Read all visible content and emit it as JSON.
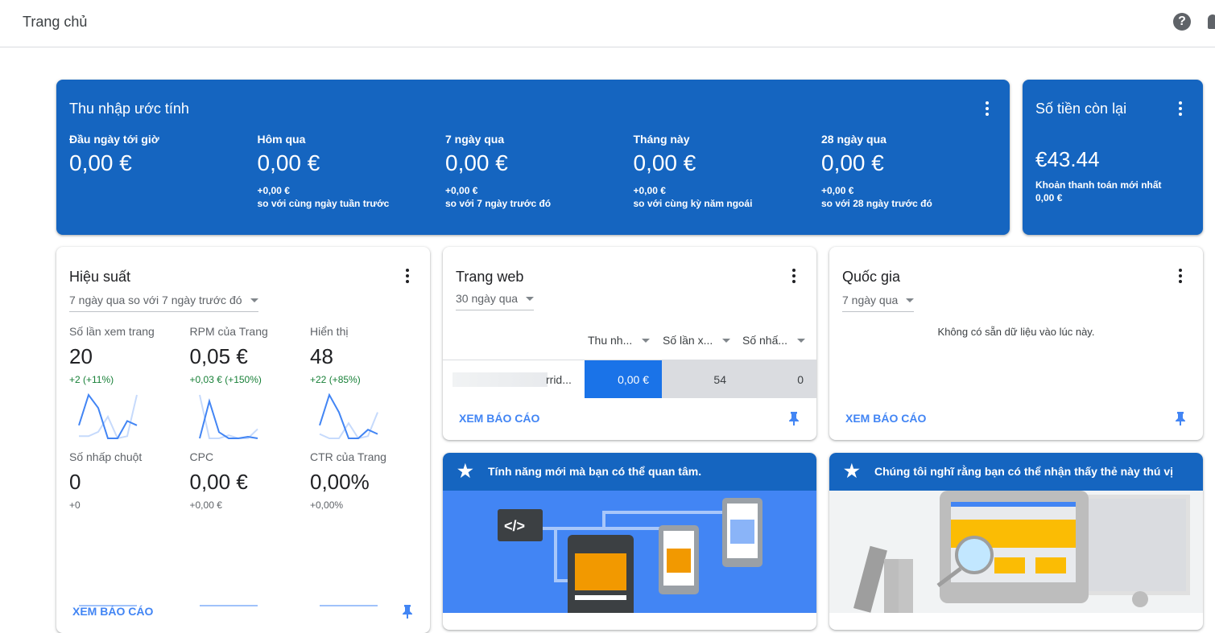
{
  "header": {
    "title": "Trang chủ",
    "help_icon": "help-icon",
    "notification_icon": "bell-icon"
  },
  "earnings": {
    "title": "Thu nhập ước tính",
    "metrics": [
      {
        "label": "Đầu ngày tới giờ",
        "value": "0,00 €",
        "delta": "",
        "compare": ""
      },
      {
        "label": "Hôm qua",
        "value": "0,00 €",
        "delta": "+0,00 €",
        "compare": "so với cùng ngày tuần trước"
      },
      {
        "label": "7 ngày qua",
        "value": "0,00 €",
        "delta": "+0,00 €",
        "compare": "so với 7 ngày trước đó"
      },
      {
        "label": "Tháng này",
        "value": "0,00 €",
        "delta": "+0,00 €",
        "compare": "so với cùng kỳ năm ngoái"
      },
      {
        "label": "28 ngày qua",
        "value": "0,00 €",
        "delta": "+0,00 €",
        "compare": "so với 28 ngày trước đó"
      }
    ]
  },
  "balance": {
    "title": "Số tiền còn lại",
    "value": "€43.44",
    "last_payment_label": "Khoản thanh toán mới nhất",
    "last_payment_value": "0,00 €"
  },
  "performance": {
    "title": "Hiệu suất",
    "range": "7 ngày qua so với 7 ngày trước đó",
    "link": "XEM BÁO CÁO",
    "metrics": [
      {
        "label": "Số lần xem trang",
        "value": "20",
        "delta": "+2 (+11%)",
        "current": [
          6,
          20,
          14,
          0,
          0,
          8,
          6
        ],
        "previous": [
          1,
          1,
          3,
          10,
          0,
          1,
          20
        ]
      },
      {
        "label": "RPM của Trang",
        "value": "0,05 €",
        "delta": "+0,03 € (+150%)",
        "current": [
          0,
          12,
          2,
          0,
          0,
          0.5,
          0
        ],
        "previous": [
          14,
          0,
          0,
          1,
          0,
          0,
          3
        ]
      },
      {
        "label": "Hiển thị",
        "value": "48",
        "delta": "+22 (+85%)",
        "current": [
          6,
          20,
          12,
          0,
          0,
          4,
          2
        ],
        "previous": [
          2,
          0,
          0,
          7,
          0,
          1,
          12
        ]
      },
      {
        "label": "Số nhấp chuột",
        "value": "0",
        "delta": "+0",
        "current": [
          0,
          0,
          0,
          0,
          0,
          0,
          0
        ],
        "previous": [
          0,
          0,
          0,
          0,
          0,
          0,
          0
        ]
      },
      {
        "label": "CPC",
        "value": "0,00 €",
        "delta": "+0,00 €",
        "current": [
          0,
          0,
          0,
          0,
          0,
          0,
          0
        ],
        "previous": [
          0,
          0,
          0,
          0,
          0,
          0,
          0
        ]
      },
      {
        "label": "CTR của Trang",
        "value": "0,00%",
        "delta": "+0,00%",
        "current": [
          0,
          0,
          0,
          0,
          0,
          0,
          0
        ],
        "previous": [
          0,
          0,
          0,
          0,
          0,
          0,
          0
        ]
      }
    ]
  },
  "sites": {
    "title": "Trang web",
    "range": "30 ngày qua",
    "columns": [
      "Thu nh...",
      "Số lần x...",
      "Số nhấ..."
    ],
    "rows": [
      {
        "site": "rrid...",
        "earnings": "0,00 €",
        "views": "54",
        "clicks": "0"
      }
    ],
    "link": "XEM BÁO CÁO"
  },
  "countries": {
    "title": "Quốc gia",
    "range": "7 ngày qua",
    "empty": "Không có sẵn dữ liệu vào lúc này.",
    "link": "XEM BÁO CÁO"
  },
  "feature1": {
    "title": "Tính năng mới mà bạn có thể quan tâm.",
    "code_glyph": "</>"
  },
  "feature2": {
    "title": "Chúng tôi nghĩ rằng bạn có thể nhận thấy thẻ này thú vị"
  },
  "colors": {
    "brand": "#1565c0",
    "accent": "#1a73e8",
    "positive": "#188038"
  }
}
